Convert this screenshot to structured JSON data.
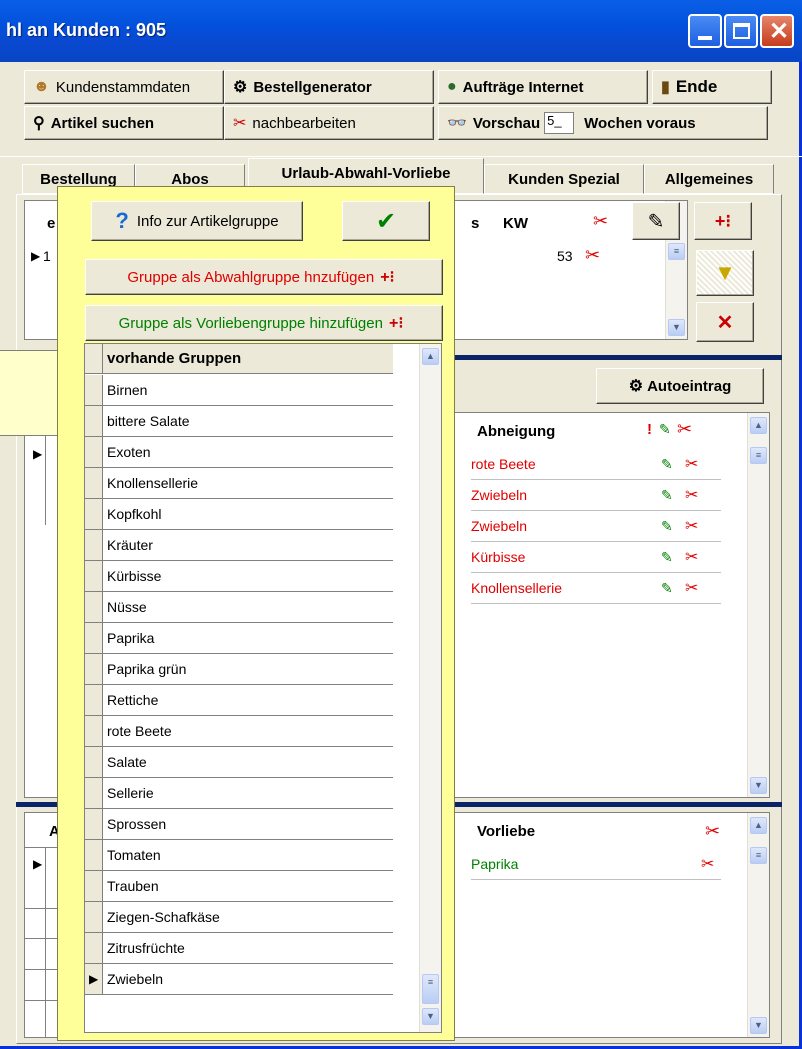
{
  "window": {
    "title": "hl an Kunden :  905",
    "controls": [
      "minimize",
      "maximize",
      "close"
    ]
  },
  "toolbar": {
    "kundenstammdaten": "Kundenstammdaten",
    "bestellgenerator": "Bestellgenerator",
    "auftraege": "Aufträge Internet",
    "ende": "Ende",
    "artikel_suchen": "Artikel suchen",
    "nachbearbeiten": "nachbearbeiten",
    "vorschau": "Vorschau",
    "vorschau_value": "5_",
    "wochen": "Wochen voraus"
  },
  "tabs": [
    "Bestellung",
    "Abos",
    "Urlaub-Abwahl-Vorliebe",
    "Kunden Spezial",
    "Allgemeines"
  ],
  "urlaub_grid": {
    "col_a": "e",
    "col_b": "s",
    "col_kw": "KW",
    "row_first": "1",
    "row_kw": "53"
  },
  "autoeintrag": "Autoeintrag",
  "abneigung": {
    "header": "Abneigung",
    "flag": "!",
    "rows": [
      "rote Beete",
      "Zwiebeln",
      "Zwiebeln",
      "Kürbisse",
      "Knollensellerie"
    ]
  },
  "vorliebe": {
    "header": "Vorliebe",
    "col_a": "A",
    "rows": [
      "Paprika"
    ]
  },
  "popup": {
    "info_button": "Info zur Artikelgruppe",
    "ok_button": "✔",
    "abwahl_button": "Gruppe als Abwahlgruppe hnzufügen",
    "vorliebe_button": "Gruppe als Vorliebengruppe hinzufügen",
    "list_header": "vorhande Gruppen",
    "items": [
      "Birnen",
      "bittere Salate",
      "Exoten",
      "Knollensellerie",
      "Kopfkohl",
      "Kräuter",
      "Kürbisse",
      "Nüsse",
      "Paprika",
      "Paprika grün",
      "Rettiche",
      "rote Beete",
      "Salate",
      "Sellerie",
      "Sprossen",
      "Tomaten",
      "Trauben",
      "Ziegen-Schafkäse",
      "Zitrusfrüchte",
      "Zwiebeln"
    ],
    "selected_item": "Zwiebeln"
  },
  "colors": {
    "title_blue": "#0a5fe6",
    "popup_yellow": "#ffff99",
    "abwahl_red": "#e00000",
    "vorliebe_green": "#008000"
  }
}
